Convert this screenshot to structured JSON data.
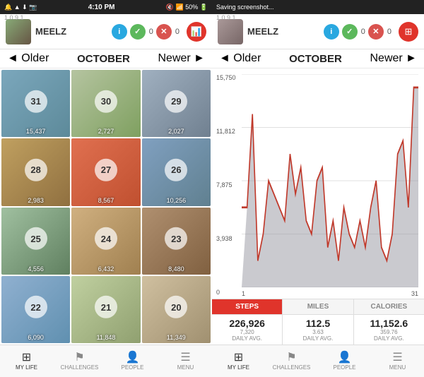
{
  "statusBar": {
    "left": "🔔 ▲ ⬇ 📷 ⬇",
    "time": "4:10 PM",
    "right": "🔇 📶 50% 🔋",
    "saving": "Saving screenshot..."
  },
  "version": "1.0.9.1",
  "user": {
    "name": "MEELZ",
    "badge_info": "i",
    "badge_check_count": "0",
    "badge_x_count": "0"
  },
  "month": {
    "title": "OCTOBER",
    "older": "◄ Older",
    "newer": "Newer ►"
  },
  "days": [
    {
      "number": "31",
      "steps": "15,437",
      "color": 1
    },
    {
      "number": "30",
      "steps": "2,727",
      "color": 2
    },
    {
      "number": "29",
      "steps": "2,027",
      "color": 3
    },
    {
      "number": "28",
      "steps": "2,983",
      "color": 4
    },
    {
      "number": "27",
      "steps": "8,567",
      "color": 5
    },
    {
      "number": "26",
      "steps": "10,256",
      "color": 6
    },
    {
      "number": "25",
      "steps": "4,556",
      "color": 7
    },
    {
      "number": "24",
      "steps": "6,432",
      "color": 8
    },
    {
      "number": "23",
      "steps": "8,480",
      "color": 9
    },
    {
      "number": "22",
      "steps": "6,090",
      "color": 10
    },
    {
      "number": "21",
      "steps": "11,848",
      "color": 11
    },
    {
      "number": "20",
      "steps": "11,349",
      "color": 12
    }
  ],
  "chart": {
    "yLabels": [
      "15,750",
      "11,812",
      "7,875",
      "3,938",
      "0"
    ],
    "xLabels": [
      "1",
      "31"
    ]
  },
  "statTabs": [
    {
      "label": "STEPS",
      "active": true
    },
    {
      "label": "MILES",
      "active": false
    },
    {
      "label": "CALORIES",
      "active": false
    }
  ],
  "statValues": [
    {
      "main": "226,926",
      "sub": "7,320",
      "subLabel": "DAILY AVG."
    },
    {
      "main": "112.5",
      "sub": "3.63",
      "subLabel": "DAILY AVG."
    },
    {
      "main": "11,152.6",
      "sub": "359.76",
      "subLabel": "DAILY AVG."
    }
  ],
  "bottomNav": [
    {
      "label": "MY LIFE",
      "icon": "grid",
      "active": true
    },
    {
      "label": "CHALLENGES",
      "icon": "flag",
      "active": false
    },
    {
      "label": "PEOPLE",
      "icon": "person",
      "active": false
    },
    {
      "label": "MENU",
      "icon": "menu",
      "active": false
    }
  ]
}
